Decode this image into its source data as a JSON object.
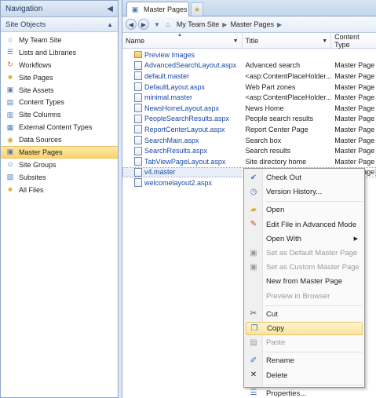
{
  "navigation": {
    "title": "Navigation",
    "pin_icon": "pin-icon",
    "group_title": "Site Objects",
    "items": [
      {
        "label": "My Team Site",
        "icon": "site-home-icon",
        "color": "#4a79c4"
      },
      {
        "label": "Lists and Libraries",
        "icon": "lists-icon",
        "color": "#4a79c4"
      },
      {
        "label": "Workflows",
        "icon": "workflow-icon",
        "color": "#d86a1e"
      },
      {
        "label": "Site Pages",
        "icon": "folder-icon",
        "color": "#e3b33b"
      },
      {
        "label": "Site Assets",
        "icon": "assets-icon",
        "color": "#5a7fb5"
      },
      {
        "label": "Content Types",
        "icon": "content-types-icon",
        "color": "#4a79c4"
      },
      {
        "label": "Site Columns",
        "icon": "columns-icon",
        "color": "#4a79c4"
      },
      {
        "label": "External Content Types",
        "icon": "external-content-icon",
        "color": "#4a79c4"
      },
      {
        "label": "Data Sources",
        "icon": "database-icon",
        "color": "#d5a83a"
      },
      {
        "label": "Master Pages",
        "icon": "master-pages-icon",
        "color": "#4a79c4",
        "selected": true
      },
      {
        "label": "Site Groups",
        "icon": "groups-icon",
        "color": "#4a79c4"
      },
      {
        "label": "Subsites",
        "icon": "subsites-icon",
        "color": "#4a79c4"
      },
      {
        "label": "All Files",
        "icon": "folder-icon",
        "color": "#e3b33b"
      }
    ]
  },
  "tabs": {
    "active_label": "Master Pages",
    "new_tab_icon": "new-tab-icon"
  },
  "breadcrumb": {
    "back_icon": "back-arrow-icon",
    "forward_icon": "forward-arrow-icon",
    "items": [
      "My Team Site",
      "Master Pages"
    ]
  },
  "columns": {
    "name": "Name",
    "title": "Title",
    "type": "Content Type"
  },
  "files": [
    {
      "name": "Preview Images",
      "title": "",
      "type": "",
      "folder": true
    },
    {
      "name": "AdvancedSearchLayout.aspx",
      "title": "Advanced search",
      "type": "Master Page"
    },
    {
      "name": "default.master",
      "title": "<asp:ContentPlaceHolder...",
      "type": "Master Page"
    },
    {
      "name": "DefaultLayout.aspx",
      "title": "Web Part zones",
      "type": "Master Page"
    },
    {
      "name": "minimal.master",
      "title": "<asp:ContentPlaceHolder...",
      "type": "Master Page"
    },
    {
      "name": "NewsHomeLayout.aspx",
      "title": "News Home",
      "type": "Master Page"
    },
    {
      "name": "PeopleSearchResults.aspx",
      "title": "People search results",
      "type": "Master Page"
    },
    {
      "name": "ReportCenterLayout.aspx",
      "title": "Report Center Page",
      "type": "Master Page"
    },
    {
      "name": "SearchMain.aspx",
      "title": "Search box",
      "type": "Master Page"
    },
    {
      "name": "SearchResults.aspx",
      "title": "Search results",
      "type": "Master Page"
    },
    {
      "name": "TabViewPageLayout.aspx",
      "title": "Site directory home",
      "type": "Master Page"
    },
    {
      "name": "v4.master",
      "title": "<asp:ContentPlaceHolder...",
      "type": "Master Page",
      "selected": true
    },
    {
      "name": "welcomelayout2.aspx",
      "title": "",
      "type": ""
    }
  ],
  "context_menu": [
    {
      "label": "Check Out",
      "icon": "check-out-icon",
      "color": "#3f6fb6"
    },
    {
      "label": "Version History...",
      "icon": "version-history-icon",
      "color": "#3f6fb6"
    },
    {
      "sep": true
    },
    {
      "label": "Open",
      "icon": "open-folder-icon",
      "color": "#e0b040"
    },
    {
      "label": "Edit File in Advanced Mode",
      "icon": "edit-file-icon",
      "color": "#c0501e"
    },
    {
      "label": "Open With",
      "icon": "",
      "submenu": true
    },
    {
      "label": "Set as Default Master Page",
      "icon": "default-master-icon",
      "disabled": true,
      "color": "#9a9a9a"
    },
    {
      "label": "Set as Custom Master Page",
      "icon": "custom-master-icon",
      "disabled": true,
      "color": "#9a9a9a"
    },
    {
      "label": "New from Master Page",
      "icon": ""
    },
    {
      "label": "Preview in Browser",
      "icon": "",
      "disabled": true
    },
    {
      "sep": true
    },
    {
      "label": "Cut",
      "icon": "cut-icon",
      "color": "#2d4f86"
    },
    {
      "label": "Copy",
      "icon": "copy-icon",
      "color": "#3f6fb6",
      "highlighted": true
    },
    {
      "label": "Paste",
      "icon": "paste-icon",
      "disabled": true,
      "color": "#9a9a9a"
    },
    {
      "sep": true
    },
    {
      "label": "Rename",
      "icon": "rename-icon",
      "color": "#3f6fb6"
    },
    {
      "label": "Delete",
      "icon": "delete-icon",
      "color": "#1e1e1e"
    },
    {
      "sep": true
    },
    {
      "label": "Properties...",
      "icon": "properties-icon",
      "color": "#3f6fb6"
    }
  ]
}
